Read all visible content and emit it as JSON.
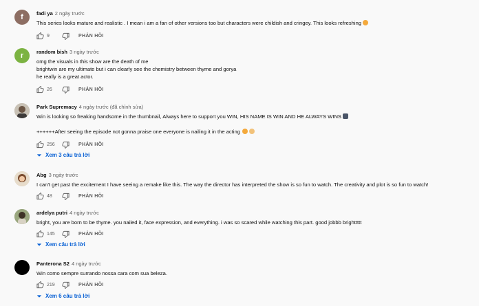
{
  "comments": [
    {
      "author": "fadi ya",
      "time": "2 ngày trước",
      "avatar_letter": "f",
      "avatar_color": "#8d6e63",
      "lines": [
        "This series looks mature and realistic . I mean i am a fan of other versions too but characters were childish and cringey. This looks refreshing"
      ],
      "likes": "9",
      "reply_label": "PHẢN HỒI"
    },
    {
      "author": "random bish",
      "time": "3 ngày trước",
      "avatar_letter": "r",
      "avatar_color": "#7cb342",
      "lines": [
        "omg the visuals in this show are the death of me",
        "brightwin are my ultimate but i can clearly see the chemistry between thyme and gorya",
        "he really is a great actor."
      ],
      "likes": "26",
      "reply_label": "PHẢN HỒI"
    },
    {
      "author": "Park Supremacy",
      "time": "4 ngày trước (đã chỉnh sửa)",
      "lines": [
        "Win is looking so freaking handsome in the thumbnail, Always here to support you WIN, HIS NAME IS WIN AND HE ALWAYS WINS",
        "",
        "++++++After seeing the episode not gonna praise one everyone is nailing it in the acting"
      ],
      "likes": "256",
      "reply_label": "PHẢN HỒI",
      "replies_label": "Xem 3 câu trả lời"
    },
    {
      "author": "Abg",
      "time": "3 ngày trước",
      "lines": [
        "I can't get past the excitement I have seeing a remake like this. The way the director has interpreted the show is so fun to watch. The creativity and plot is so fun to watch!"
      ],
      "likes": "48",
      "reply_label": "PHẢN HỒI"
    },
    {
      "author": "ardelya putri",
      "time": "4 ngày trước",
      "lines": [
        "bright, you are born to be thyme. you nailed it, face expression, and everything.  i was so scared while watching this part. good jobbb brighttttt"
      ],
      "likes": "145",
      "reply_label": "PHẢN HỒI",
      "replies_label": "Xem câu trả lời"
    },
    {
      "author": "Panterona S2",
      "time": "4 ngày trước",
      "lines": [
        "Win como sempre surrando nossa cara com sua beleza."
      ],
      "likes": "219",
      "reply_label": "PHẢN HỒI",
      "replies_label": "Xem 6 câu trả lời"
    }
  ]
}
